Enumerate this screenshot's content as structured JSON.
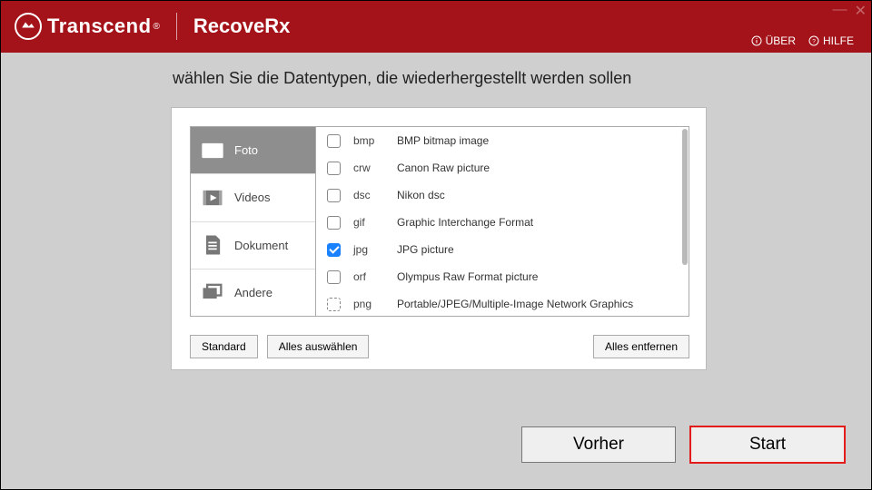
{
  "header": {
    "brand": "Transcend",
    "reg": "®",
    "product": "RecoveRx",
    "about": "ÜBER",
    "help": "HILFE",
    "minimize": "—",
    "close": "✕"
  },
  "instruction": "wählen Sie die Datentypen, die wiederhergestellt werden sollen",
  "categories": [
    {
      "key": "foto",
      "label": "Foto",
      "active": true
    },
    {
      "key": "videos",
      "label": "Videos",
      "active": false
    },
    {
      "key": "dokument",
      "label": "Dokument",
      "active": false
    },
    {
      "key": "andere",
      "label": "Andere",
      "active": false
    }
  ],
  "filetypes": [
    {
      "ext": "bmp",
      "desc": "BMP bitmap image",
      "checked": false,
      "dotted": false
    },
    {
      "ext": "crw",
      "desc": "Canon Raw picture",
      "checked": false,
      "dotted": false
    },
    {
      "ext": "dsc",
      "desc": "Nikon dsc",
      "checked": false,
      "dotted": false
    },
    {
      "ext": "gif",
      "desc": "Graphic Interchange Format",
      "checked": false,
      "dotted": false
    },
    {
      "ext": "jpg",
      "desc": "JPG picture",
      "checked": true,
      "dotted": false
    },
    {
      "ext": "orf",
      "desc": "Olympus Raw Format picture",
      "checked": false,
      "dotted": false
    },
    {
      "ext": "png",
      "desc": "Portable/JPEG/Multiple-Image Network Graphics",
      "checked": false,
      "dotted": true
    }
  ],
  "buttons": {
    "standard": "Standard",
    "selectall": "Alles auswählen",
    "removeall": "Alles entfernen"
  },
  "nav": {
    "back": "Vorher",
    "start": "Start"
  }
}
